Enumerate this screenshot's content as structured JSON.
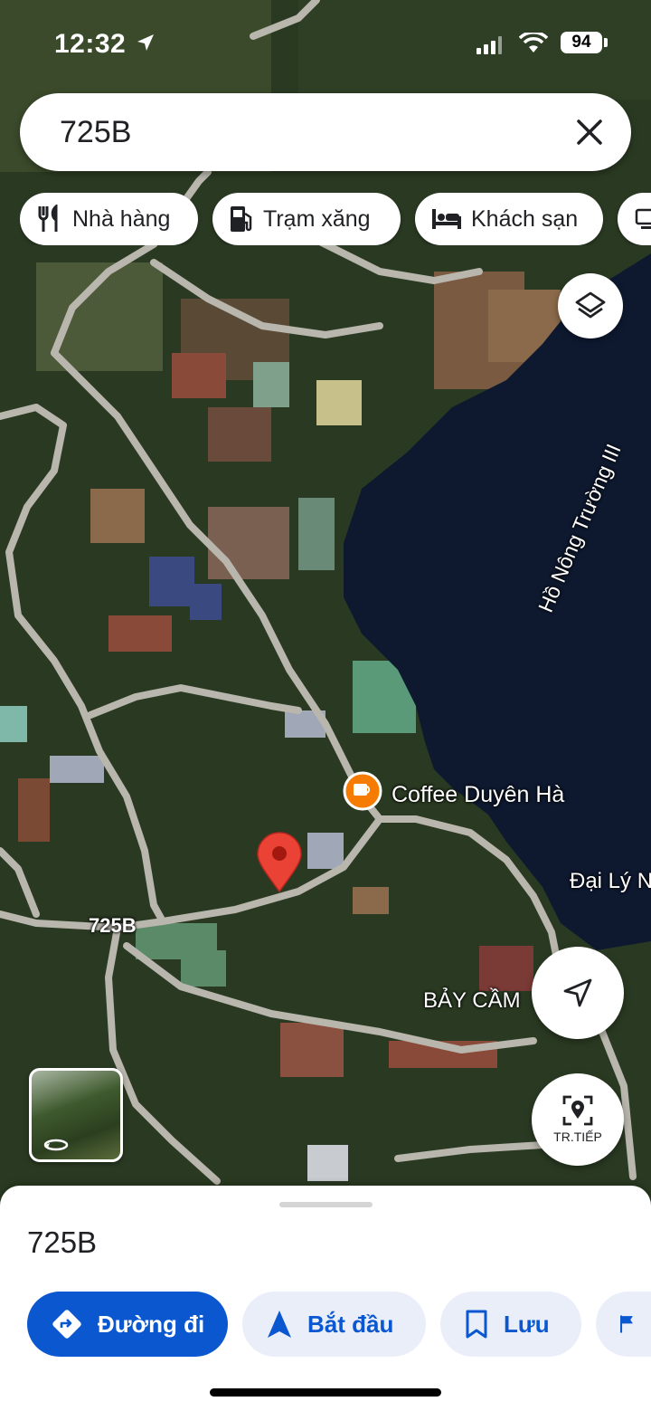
{
  "status_bar": {
    "time": "12:32",
    "battery": "94"
  },
  "search": {
    "query": "725B"
  },
  "chips": [
    {
      "label": "Nhà hàng",
      "icon": "restaurant-icon"
    },
    {
      "label": "Trạm xăng",
      "icon": "gas-station-icon"
    },
    {
      "label": "Khách sạn",
      "icon": "hotel-icon"
    },
    {
      "label": "",
      "icon": "more-icon"
    }
  ],
  "map": {
    "labels": {
      "lake": "Hồ Nông Trường III",
      "coffee": "Coffee Duyên Hà",
      "dai_ly": "Đại Lý N",
      "road": "725B",
      "bay_cam": "BẢY CẦM"
    },
    "recenter_label": "TR.TIẾP",
    "colors": {
      "water": "#0e1930",
      "road": "#b9b6ad",
      "pin": "#ea4335",
      "poi": "#f57c00"
    }
  },
  "sheet": {
    "title": "725B",
    "actions": {
      "directions": "Đường đi",
      "start": "Bắt đầu",
      "save": "Lưu"
    }
  },
  "colors": {
    "primary": "#0b57d0",
    "secondary_bg": "#e9eef9"
  }
}
